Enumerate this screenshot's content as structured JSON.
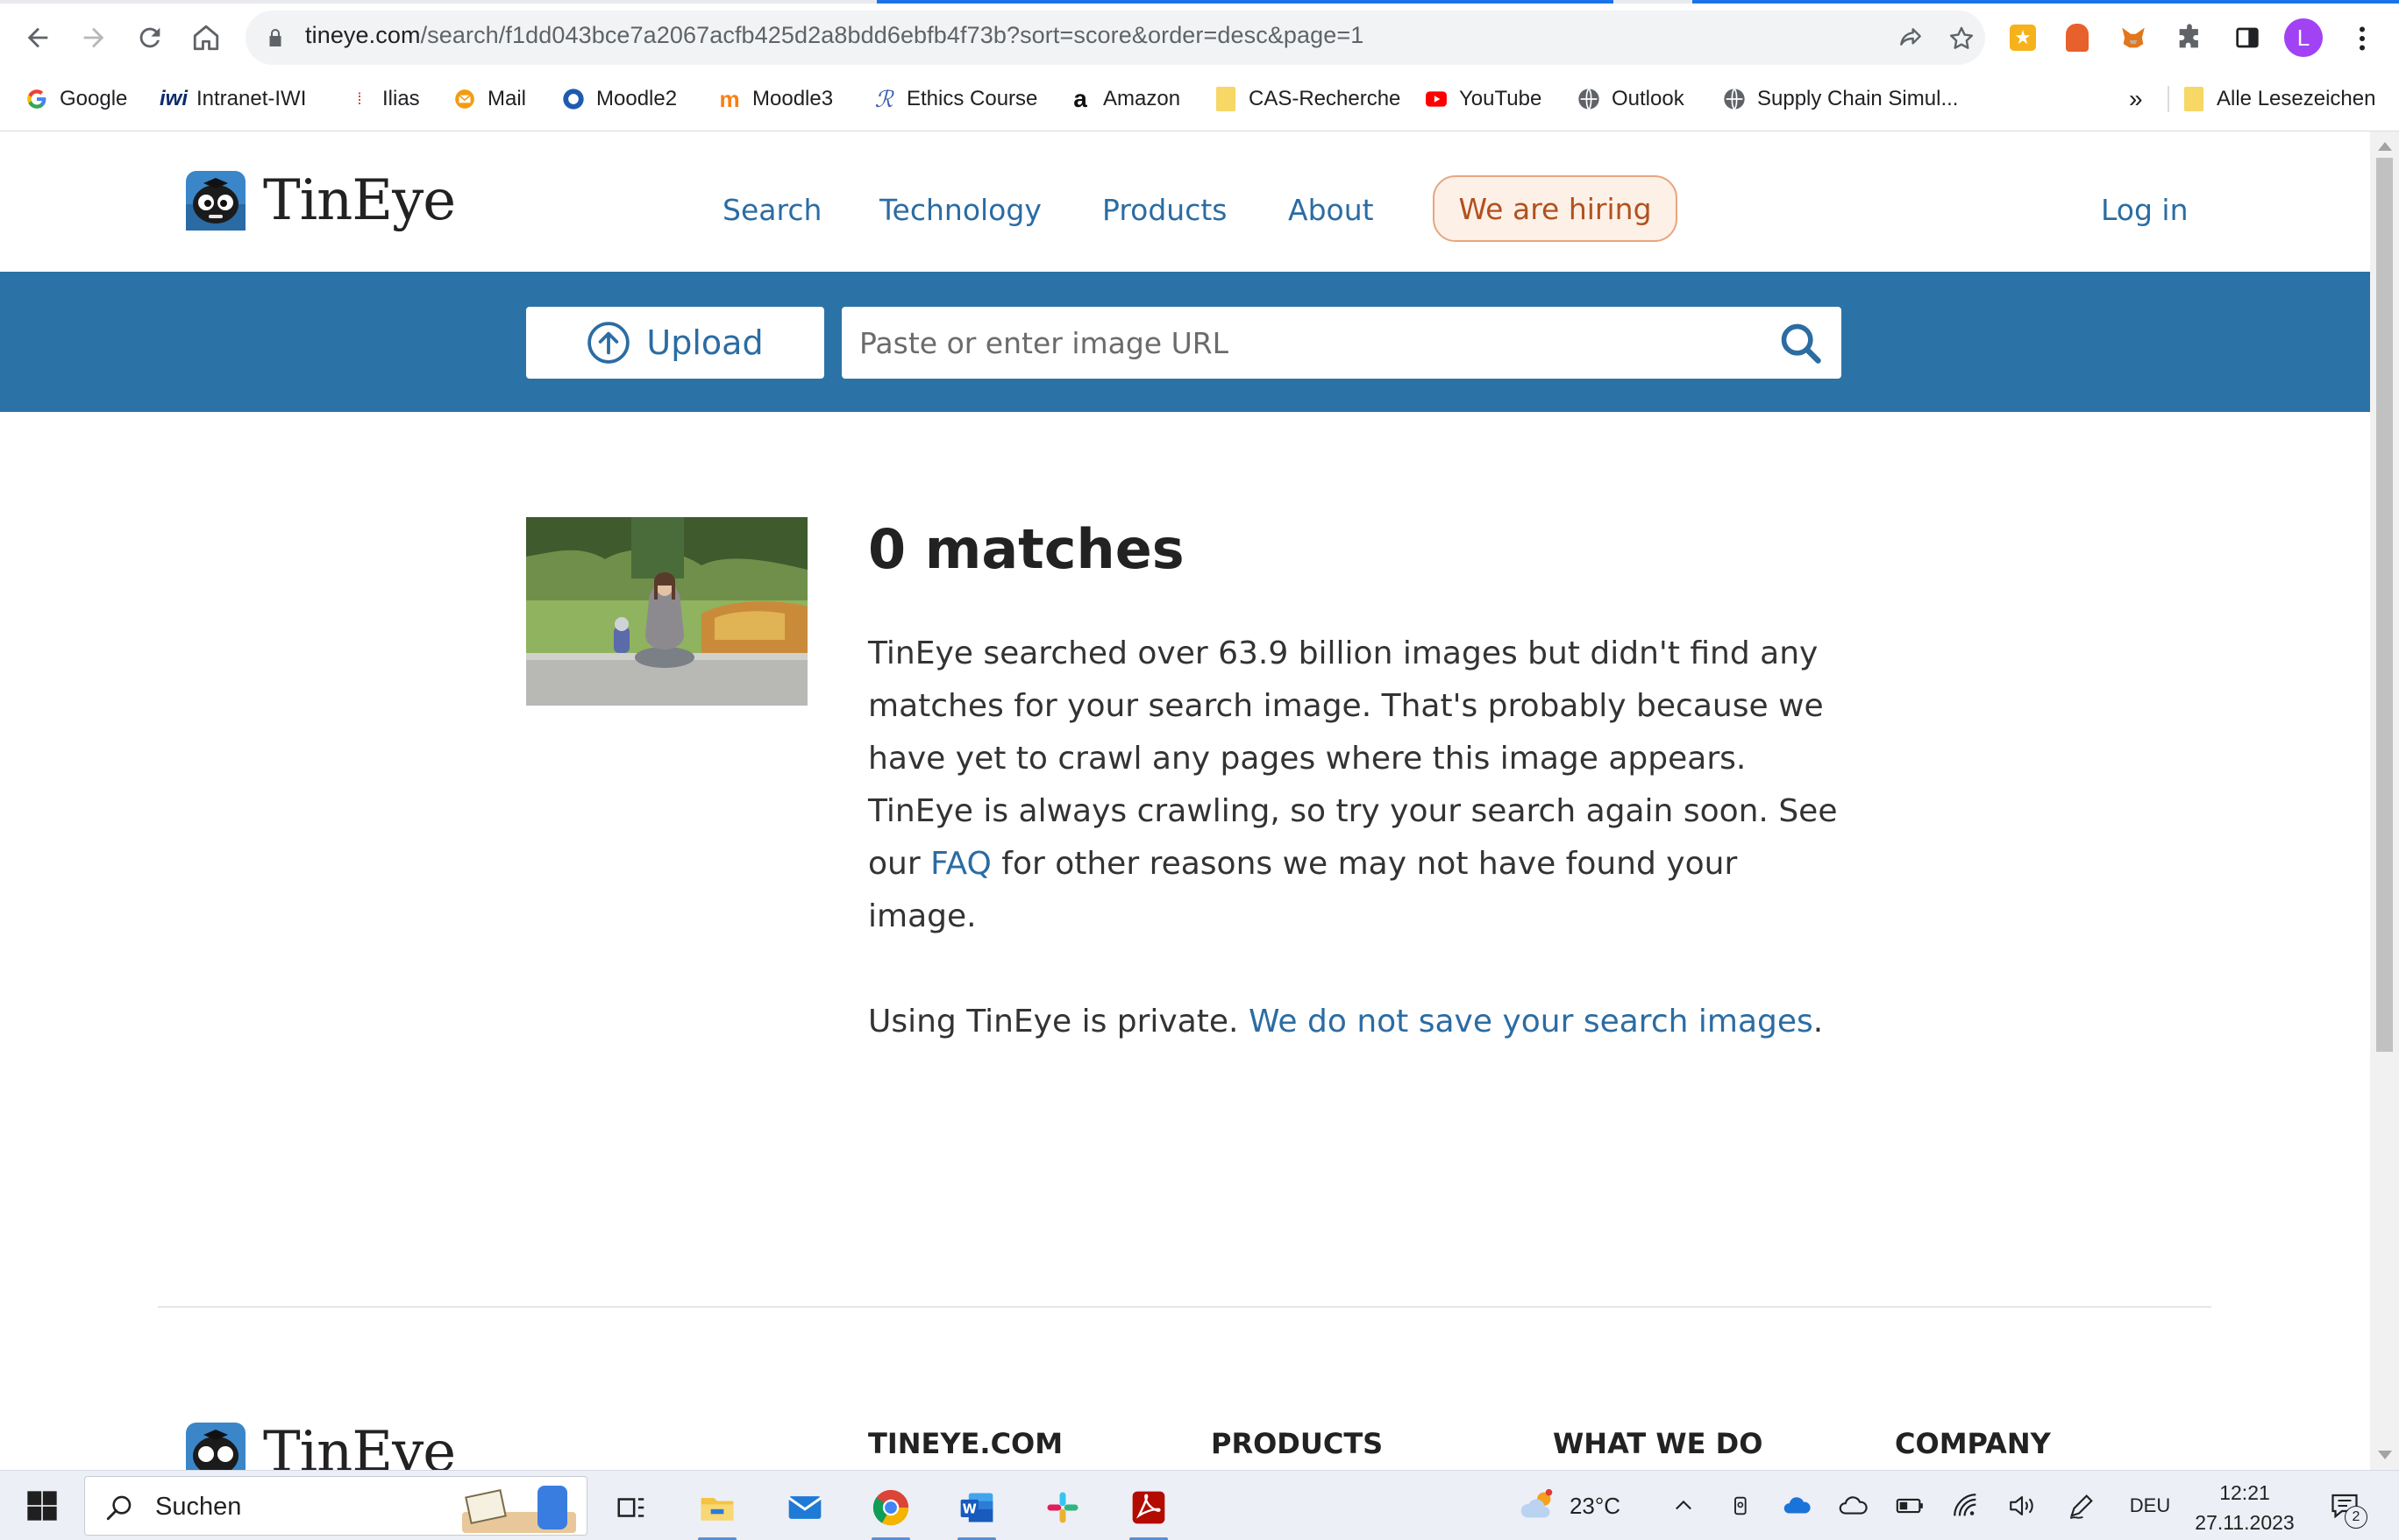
{
  "browser": {
    "url": "tineye.com/search/f1dd043bce7a2067acfb425d2a8bdd6ebfb4f73b?sort=score&order=desc&page=1",
    "url_host": "tineye.com",
    "url_path": "/search/f1dd043bce7a2067acfb425d2a8bdd6ebfb4f73b?sort=score&order=desc&page=1",
    "profile_initial": "L",
    "bookmarks": [
      {
        "label": "Google",
        "icon": "google-icon"
      },
      {
        "label": "Intranet-IWI",
        "icon": "iwi-icon"
      },
      {
        "label": "Ilias",
        "icon": "ilias-icon"
      },
      {
        "label": "Mail",
        "icon": "mail-icon"
      },
      {
        "label": "Moodle2",
        "icon": "moodle2-icon"
      },
      {
        "label": "Moodle3",
        "icon": "moodle3-icon"
      },
      {
        "label": "Ethics Course",
        "icon": "ethics-icon"
      },
      {
        "label": "Amazon",
        "icon": "amazon-icon"
      },
      {
        "label": "CAS-Recherche",
        "icon": "folder-icon"
      },
      {
        "label": "YouTube",
        "icon": "youtube-icon"
      },
      {
        "label": "Outlook",
        "icon": "globe-icon"
      },
      {
        "label": "Supply Chain Simul...",
        "icon": "globe-icon"
      }
    ],
    "bookmarks_overflow": "»",
    "all_bookmarks": "Alle Lesezeichen"
  },
  "site": {
    "logo_text": "TinEye",
    "nav": [
      "Search",
      "Technology",
      "Products",
      "About"
    ],
    "hiring": "We are hiring",
    "login": "Log in",
    "upload_label": "Upload",
    "url_placeholder": "Paste or enter image URL"
  },
  "result": {
    "title": "0 matches",
    "body_before_link": "TinEye searched over 63.9 billion images but didn't find any matches for your search image. That's probably because we have yet to crawl any pages where this image appears. TinEye is always crawling, so try your search again soon. See our ",
    "faq_link": "FAQ",
    "body_after_link": " for other reasons we may not have found your image.",
    "private_text": "Using TinEye is private. ",
    "private_link": "We do not save your search images",
    "private_end": "."
  },
  "footer": {
    "logo_text": "TinEye",
    "headings": [
      "TINEYE.COM",
      "PRODUCTS",
      "WHAT WE DO",
      "COMPANY"
    ]
  },
  "taskbar": {
    "search_label": "Suchen",
    "weather": "23°C",
    "language": "DEU",
    "time": "12:21",
    "date": "27.11.2023",
    "notifications": "2"
  },
  "colors": {
    "brand_blue": "#2b73a6",
    "link_blue": "#2b6ca3",
    "hiring_orange": "#b0521e"
  }
}
